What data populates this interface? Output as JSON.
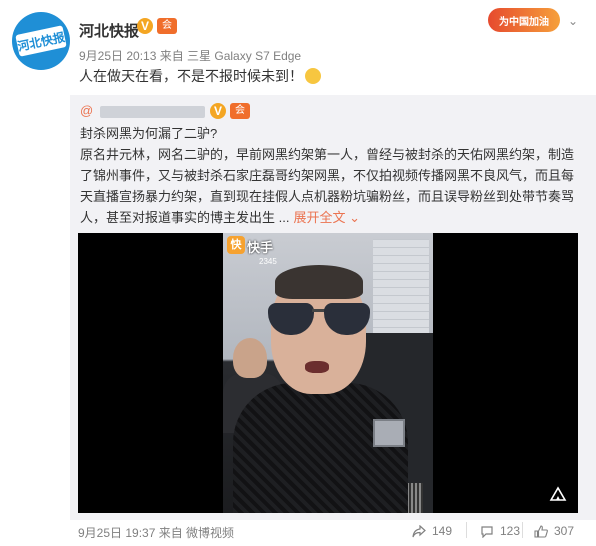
{
  "post": {
    "author": "河北快报",
    "avatar_text": "河北快报",
    "vip_badge": "会",
    "meta": "9月25日 20:13 来自 三星 Galaxy S7 Edge",
    "text": "人在做天在看，不是不报时候未到！",
    "campaign_badge": "为中国加油",
    "chevron": "⌄"
  },
  "repost": {
    "at": "@",
    "vip_badge": "会",
    "title": "封杀网黑为何漏了二驴?",
    "body": "原名井元林，网名二驴的，早前网黑约架第一人，曾经与被封杀的天佑网黑约架，制造了锦州事件，又与被封杀石家庄磊哥约架网黑，不仅拍视频传播网黑不良风气，而且每天直播宣扬暴力约架，直到现在挂假人点机器粉坑骗粉丝，而且误导粉丝到处带节奏骂人，甚至对报道事实的博主发出生 ...",
    "expand": "展开全文",
    "expand_chevron": "⌄",
    "video": {
      "logo_char": "快",
      "watermark": "快手",
      "id_text": "2345"
    },
    "footer_meta": "9月25日 19:37 来自 微博视频",
    "shares": "149",
    "comments": "123",
    "likes": "307"
  },
  "colors": {
    "link": "#eb7350",
    "meta": "#808080",
    "repost_bg": "#f2f2f5",
    "avatar_blue": "#1f8fd6"
  }
}
